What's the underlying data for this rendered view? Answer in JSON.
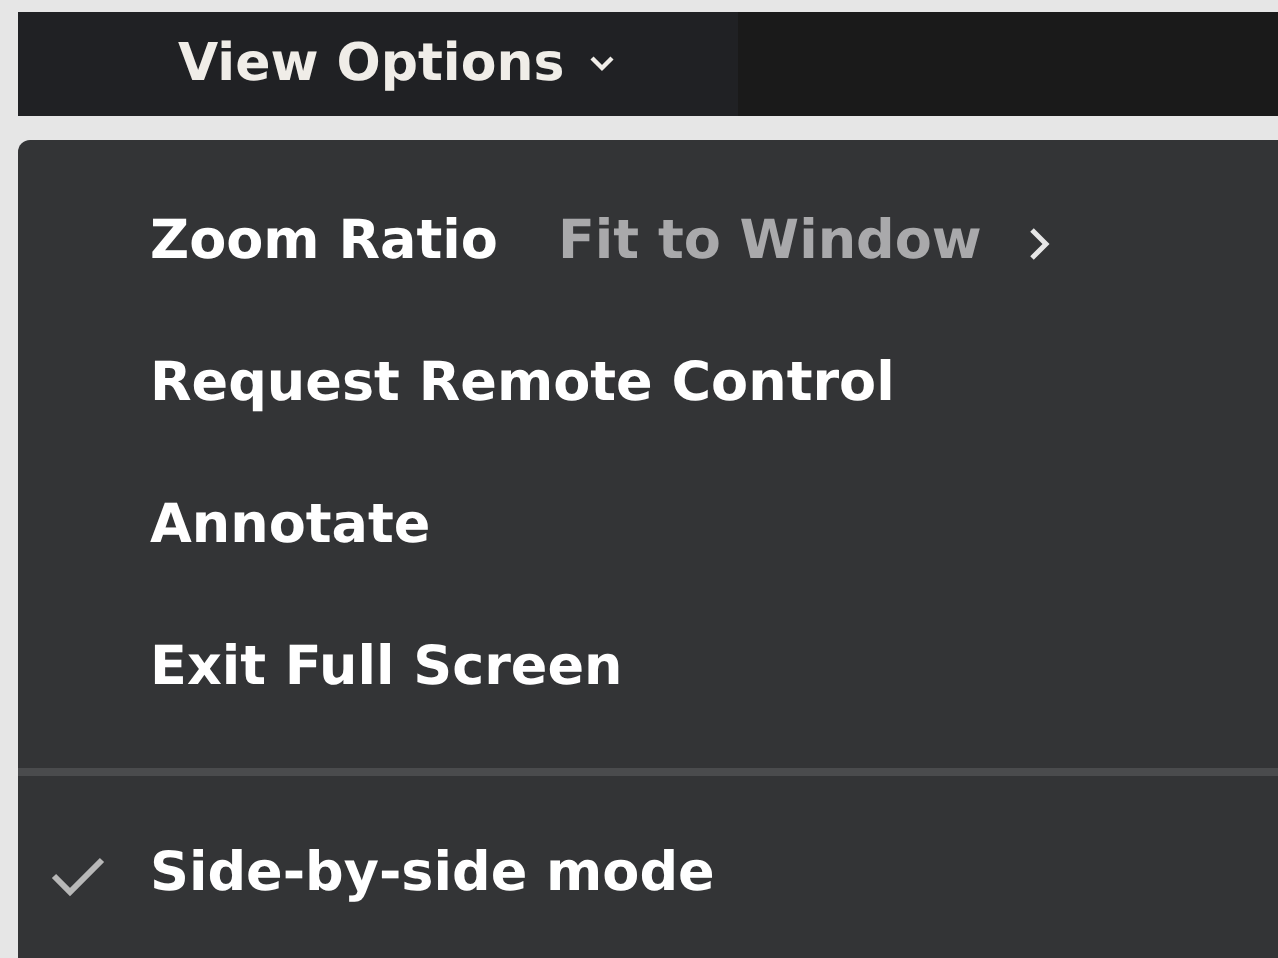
{
  "toolbar": {
    "button": {
      "label": "View Options",
      "expanded": true
    }
  },
  "menu": {
    "items": [
      {
        "kind": "submenu",
        "label": "Zoom Ratio",
        "value": "Fit to Window"
      },
      {
        "kind": "action",
        "label": "Request Remote Control"
      },
      {
        "kind": "action",
        "label": "Annotate"
      },
      {
        "kind": "action",
        "label": "Exit Full Screen"
      },
      {
        "kind": "divider"
      },
      {
        "kind": "check",
        "label": "Side-by-side mode",
        "checked": true
      }
    ]
  }
}
